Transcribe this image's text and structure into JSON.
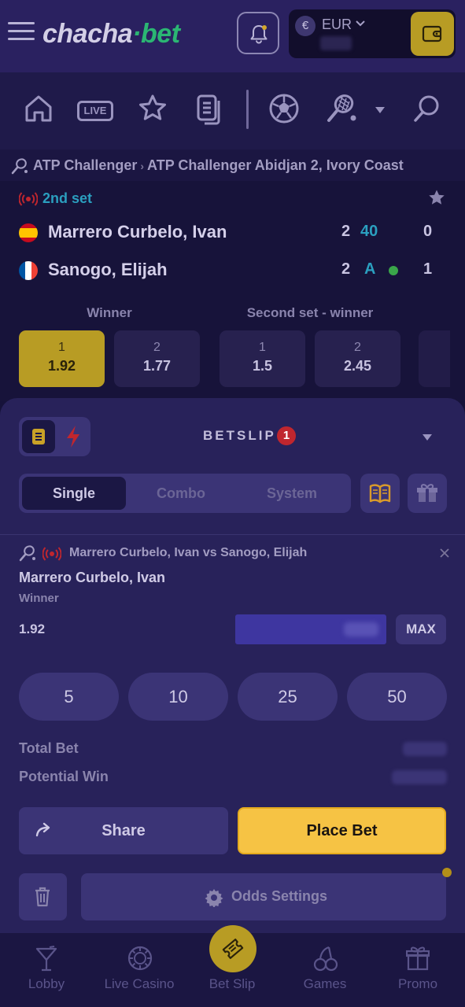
{
  "header": {
    "logo_main": "chacha",
    "logo_dot": "·",
    "logo_suffix": "bet",
    "currency_symbol": "€",
    "currency": "EUR",
    "icons": [
      "menu-icon",
      "bell-icon",
      "wallet-icon"
    ]
  },
  "sport_nav": {
    "live_label": "LIVE",
    "icons": [
      "home-icon",
      "live-icon",
      "star-icon",
      "betslip-history-icon",
      "soccer-ball-icon",
      "tennis-icon",
      "chevron-down-icon",
      "search-icon"
    ]
  },
  "breadcrumb": {
    "category": "ATP Challenger",
    "tournament": "ATP Challenger Abidjan 2, Ivory Coast"
  },
  "match": {
    "status": "2nd set",
    "players": [
      {
        "name": "Marrero Curbelo, Ivan",
        "sets": "2",
        "game": "40",
        "current_set": "0",
        "serving": false,
        "flag": "Spain"
      },
      {
        "name": "Sanogo, Elijah",
        "sets": "2",
        "game": "A",
        "current_set": "1",
        "serving": true,
        "flag": "France"
      }
    ],
    "markets": [
      {
        "label": "Winner",
        "odds": [
          {
            "name": "1",
            "value": "1.92",
            "selected": true
          },
          {
            "name": "2",
            "value": "1.77",
            "selected": false
          }
        ]
      },
      {
        "label": "Second set - winner",
        "odds": [
          {
            "name": "1",
            "value": "1.5",
            "selected": false
          },
          {
            "name": "2",
            "value": "2.45",
            "selected": false
          }
        ]
      }
    ]
  },
  "betslip": {
    "title": "BETSLIP",
    "count": "1",
    "tabs": [
      "Single",
      "Combo",
      "System"
    ],
    "active_tab": "Single",
    "selection": {
      "match": "Marrero Curbelo, Ivan vs Sanogo, Elijah",
      "pick": "Marrero Curbelo, Ivan",
      "market": "Winner",
      "odds": "1.92"
    },
    "max_label": "MAX",
    "quick_stakes": [
      "5",
      "10",
      "25",
      "50"
    ],
    "total_bet_label": "Total Bet",
    "potential_win_label": "Potential Win",
    "share_label": "Share",
    "place_bet_label": "Place Bet",
    "odds_settings_label": "Odds Settings"
  },
  "tabbar": {
    "tabs": [
      {
        "label": "Lobby",
        "icon": "cocktail-icon"
      },
      {
        "label": "Live Casino",
        "icon": "casino-chip-icon"
      },
      {
        "label": "Bet Slip",
        "icon": "ticket-icon"
      },
      {
        "label": "Games",
        "icon": "cherries-icon"
      },
      {
        "label": "Promo",
        "icon": "gift-icon"
      }
    ]
  },
  "colors": {
    "accent_gold": "#f6c344",
    "selected_odd": "#b89c24",
    "live_blue": "#2b9fbf",
    "live_red": "#c0262e",
    "brand_green": "#2bb673"
  }
}
